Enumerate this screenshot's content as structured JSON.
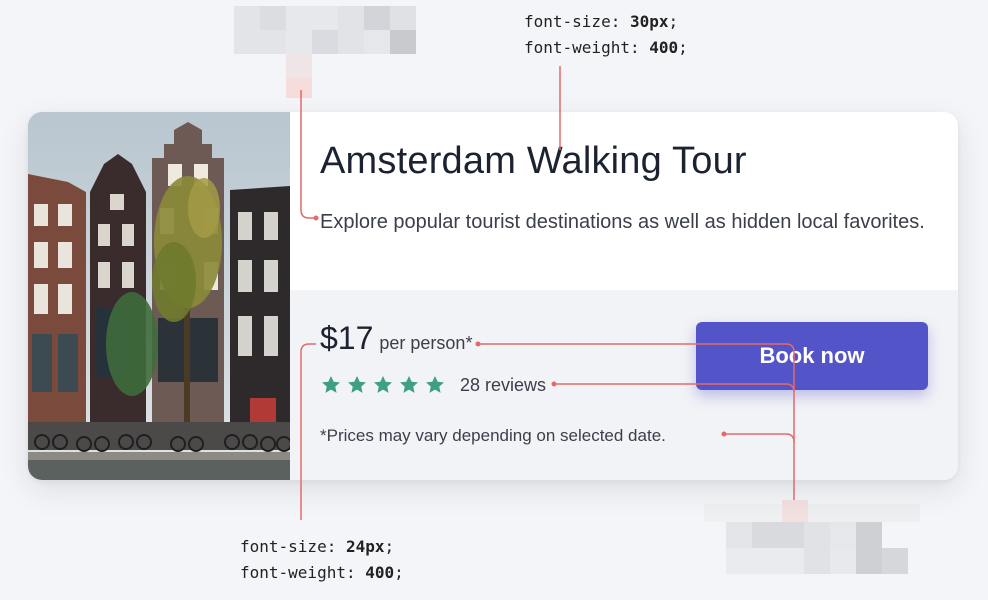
{
  "annotations": {
    "heading_spec": {
      "size_prop": "font-size: ",
      "size_val": "30px",
      "weight_prop": "font-weight: ",
      "weight_val": "400",
      "suffix": ";"
    },
    "price_spec": {
      "size_prop": "font-size: ",
      "size_val": "24px",
      "weight_prop": "font-weight: ",
      "weight_val": "400",
      "suffix": ";"
    },
    "guide_color": "#e46a68"
  },
  "card": {
    "title": "Amsterdam Walking Tour",
    "description": "Explore popular tourist destinations as well as hidden local favorites.",
    "price": "$17",
    "price_unit": "per person*",
    "rating": 5,
    "rating_max": 5,
    "star_color": "#3e9e86",
    "reviews": "28 reviews",
    "disclaimer": "*Prices may vary depending on selected date.",
    "book_label": "Book now",
    "button_color": "#5254c8"
  }
}
